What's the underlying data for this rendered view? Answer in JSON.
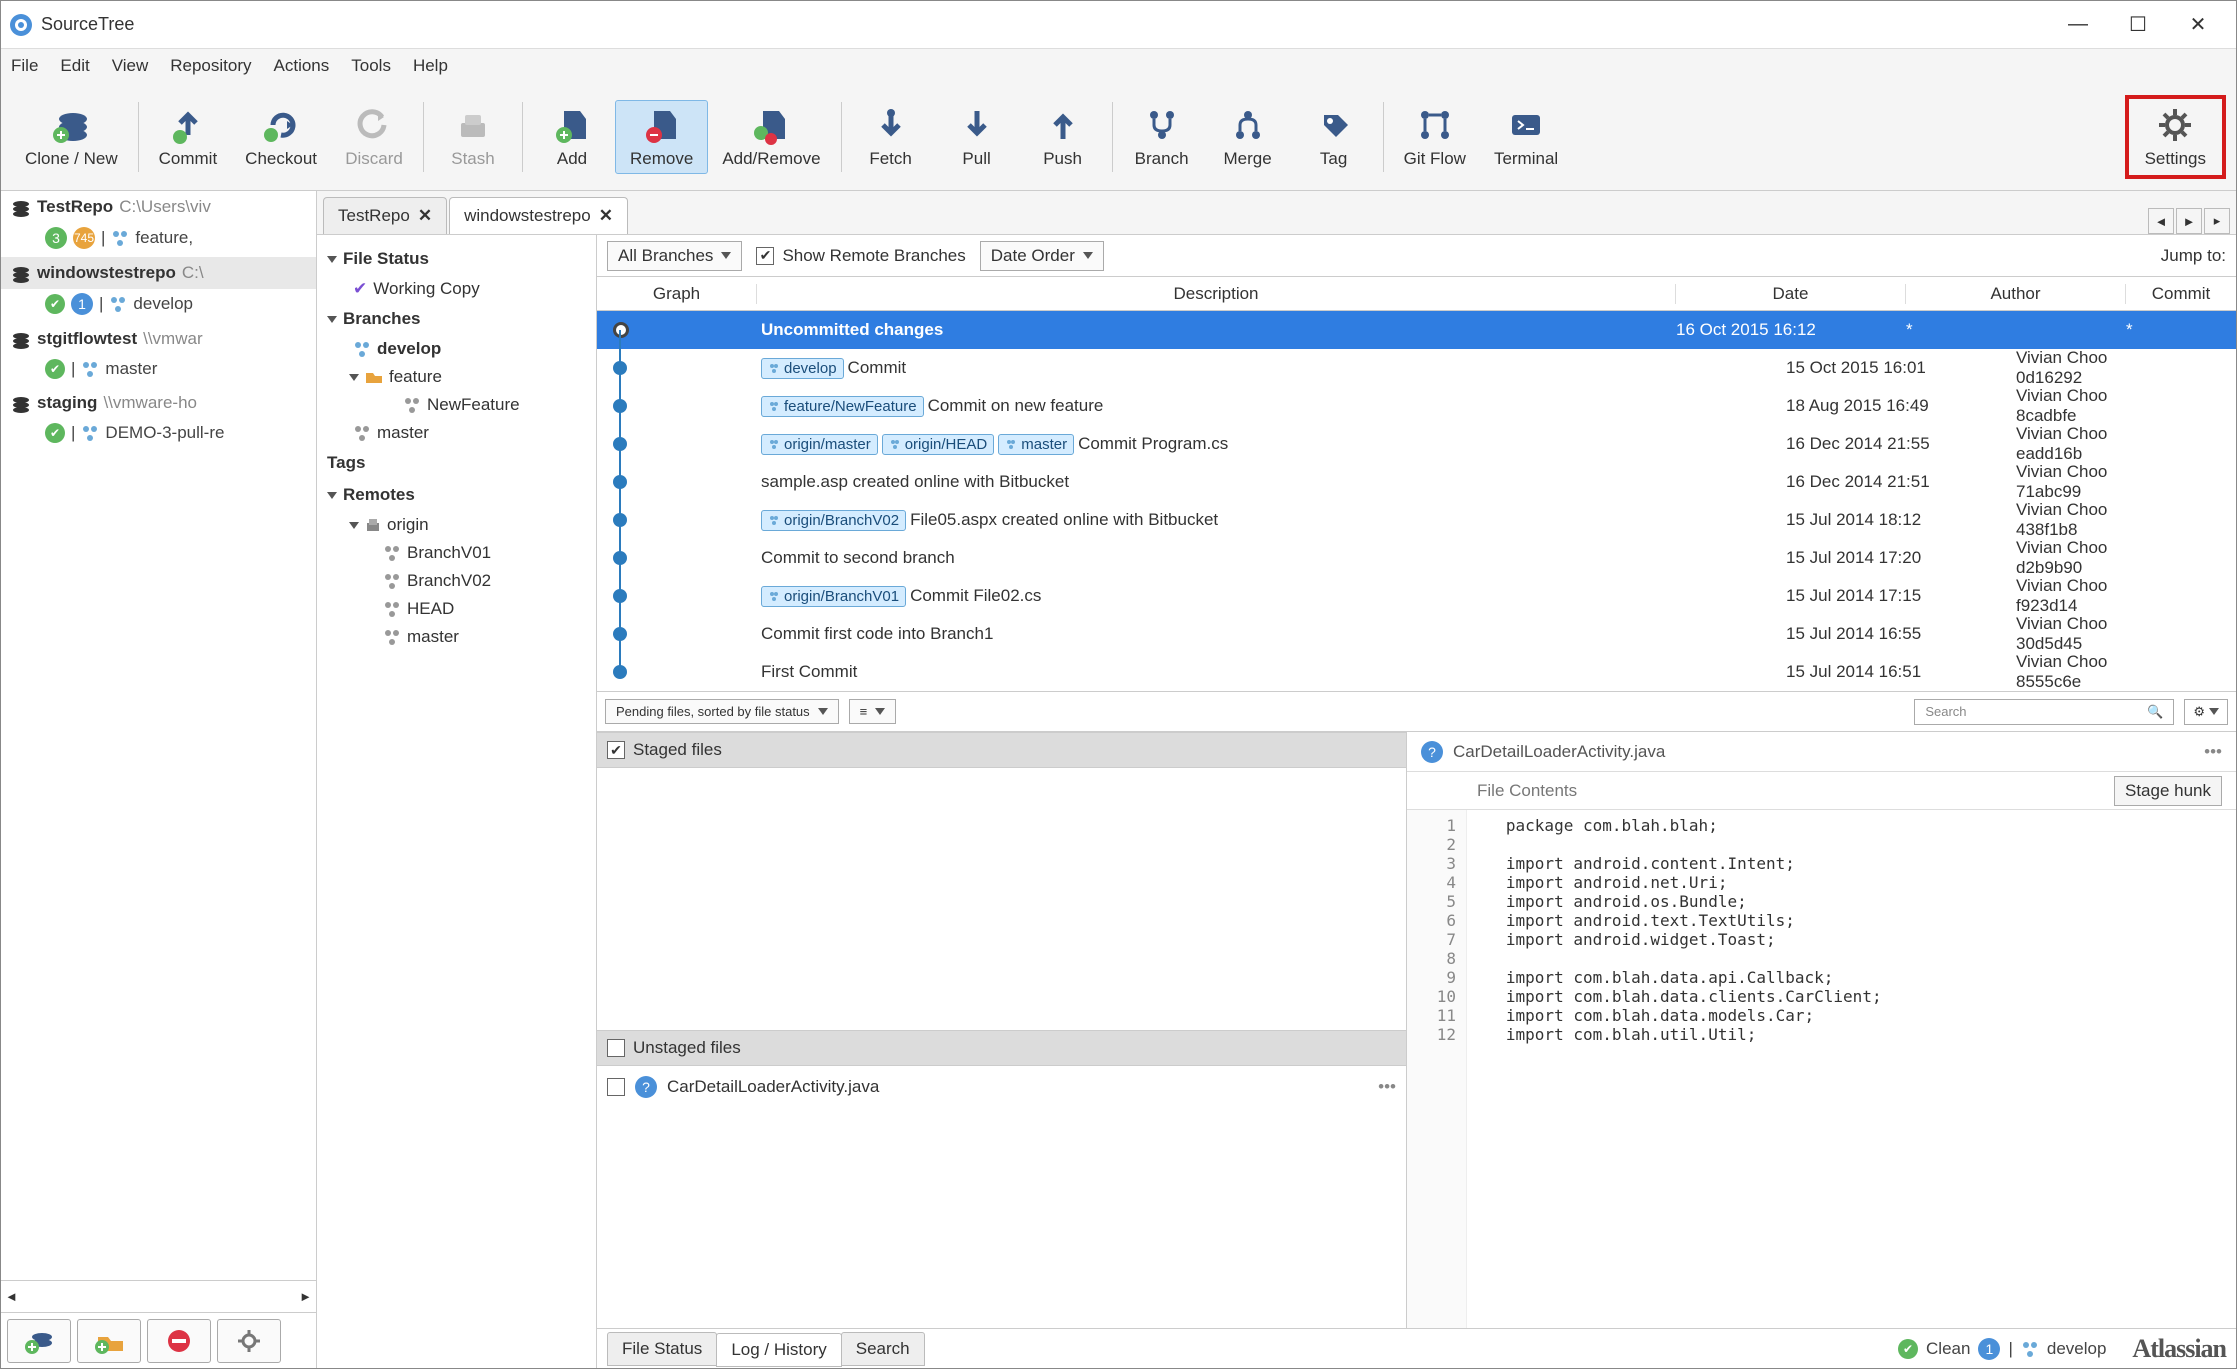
{
  "app": {
    "title": "SourceTree"
  },
  "menubar": [
    "File",
    "Edit",
    "View",
    "Repository",
    "Actions",
    "Tools",
    "Help"
  ],
  "toolbar": {
    "clone": "Clone / New",
    "commit": "Commit",
    "checkout": "Checkout",
    "discard": "Discard",
    "stash": "Stash",
    "add": "Add",
    "remove": "Remove",
    "addremove": "Add/Remove",
    "fetch": "Fetch",
    "pull": "Pull",
    "push": "Push",
    "branch": "Branch",
    "merge": "Merge",
    "tag": "Tag",
    "gitflow": "Git Flow",
    "terminal": "Terminal",
    "settings": "Settings"
  },
  "repos": [
    {
      "name": "TestRepo",
      "path": "C:\\Users\\viv",
      "sub": {
        "ahead": "3",
        "behind": "745",
        "branch": "feature,"
      }
    },
    {
      "name": "windowstestrepo",
      "path": "C:\\",
      "sub": {
        "q": "1",
        "branch": "develop"
      }
    },
    {
      "name": "stgitflowtest",
      "path": "\\\\vmwar",
      "sub": {
        "branch": "master"
      }
    },
    {
      "name": "staging",
      "path": "\\\\vmware-ho",
      "sub": {
        "branch": "DEMO-3-pull-re"
      }
    }
  ],
  "tabs": [
    {
      "label": "TestRepo",
      "active": false
    },
    {
      "label": "windowstestrepo",
      "active": true
    }
  ],
  "nav": {
    "file_status": "File Status",
    "working_copy": "Working Copy",
    "branches": "Branches",
    "develop": "develop",
    "feature": "feature",
    "new_feature": "NewFeature",
    "master": "master",
    "tags": "Tags",
    "remotes": "Remotes",
    "origin": "origin",
    "bv01": "BranchV01",
    "bv02": "BranchV02",
    "head": "HEAD"
  },
  "filters": {
    "all_branches": "All Branches",
    "show_remote": "Show Remote Branches",
    "date_order": "Date Order",
    "jump": "Jump to:"
  },
  "grid": {
    "graph": "Graph",
    "desc": "Description",
    "date": "Date",
    "author": "Author",
    "commit": "Commit"
  },
  "commits": [
    {
      "tags": [],
      "msg": "Uncommitted changes",
      "date": "16 Oct 2015 16:12",
      "author": "*",
      "hash": "*",
      "selected": true,
      "hollow": true
    },
    {
      "tags": [
        "develop"
      ],
      "msg": "Commit",
      "date": "15 Oct 2015 16:01",
      "author": "Vivian Choo <vchc",
      "hash": "0d16292"
    },
    {
      "tags": [
        "feature/NewFeature"
      ],
      "msg": "Commit on new feature",
      "date": "18 Aug 2015 16:49",
      "author": "Vivian Choo <vchc",
      "hash": "8cadbfe"
    },
    {
      "tags": [
        "origin/master",
        "origin/HEAD",
        "master"
      ],
      "msg": "Commit Program.cs",
      "date": "16 Dec 2014 21:55",
      "author": "Vivian Choo <vchc",
      "hash": "eadd16b"
    },
    {
      "tags": [],
      "msg": "sample.asp created online with Bitbucket",
      "date": "16 Dec 2014 21:51",
      "author": "Vivian Choo <vchc",
      "hash": "71abc99"
    },
    {
      "tags": [
        "origin/BranchV02"
      ],
      "msg": "File05.aspx created online with Bitbucket",
      "date": "15 Jul 2014 18:12",
      "author": "Vivian Choo <vchc",
      "hash": "438f1b8"
    },
    {
      "tags": [],
      "msg": "Commit to second branch",
      "date": "15 Jul 2014 17:20",
      "author": "Vivian Choo <vchc",
      "hash": "d2b9b90"
    },
    {
      "tags": [
        "origin/BranchV01"
      ],
      "msg": "Commit File02.cs",
      "date": "15 Jul 2014 17:15",
      "author": "Vivian Choo <vchc",
      "hash": "f923d14"
    },
    {
      "tags": [],
      "msg": "Commit first code into Branch1",
      "date": "15 Jul 2014 16:55",
      "author": "Vivian Choo <vchc",
      "hash": "30d5d45"
    },
    {
      "tags": [],
      "msg": "First Commit",
      "date": "15 Jul 2014 16:51",
      "author": "Vivian Choo <vchc",
      "hash": "8555c6e"
    }
  ],
  "pending": {
    "label": "Pending files, sorted by file status",
    "search_placeholder": "Search"
  },
  "stage": {
    "staged": "Staged files",
    "unstaged": "Unstaged files",
    "file": "CarDetailLoaderActivity.java"
  },
  "diff": {
    "filename": "CarDetailLoaderActivity.java",
    "file_contents": "File Contents",
    "stage_hunk": "Stage hunk",
    "lines": [
      "package com.blah.blah;",
      "",
      "import android.content.Intent;",
      "import android.net.Uri;",
      "import android.os.Bundle;",
      "import android.text.TextUtils;",
      "import android.widget.Toast;",
      "",
      "import com.blah.data.api.Callback;",
      "import com.blah.data.clients.CarClient;",
      "import com.blah.data.models.Car;",
      "import com.blah.util.Util;"
    ]
  },
  "status": {
    "tabs": [
      "File Status",
      "Log / History",
      "Search"
    ],
    "clean": "Clean",
    "count": "1",
    "branch": "develop",
    "brand": "Atlassian"
  }
}
